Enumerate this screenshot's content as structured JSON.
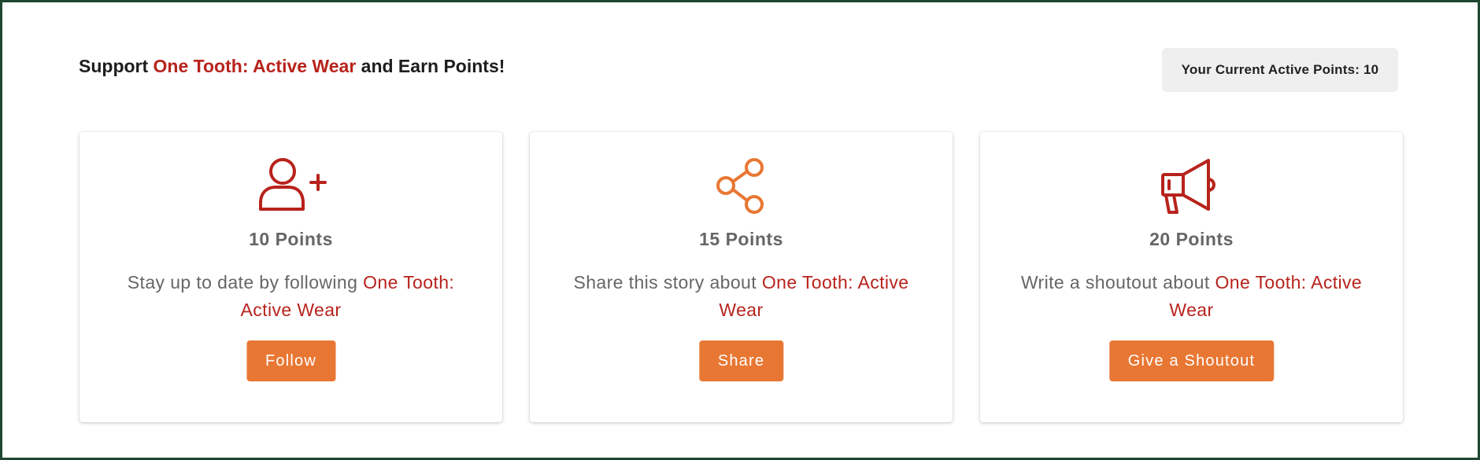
{
  "header": {
    "headline_prefix": "Support",
    "brand_name": "One Tooth: Active Wear",
    "headline_suffix": "and Earn Points!",
    "points_badge": "Your Current Active Points: 10"
  },
  "cards": [
    {
      "icon": "user-plus-icon",
      "points": "10 Points",
      "desc_prefix": "Stay up to date by following",
      "desc_brand": "One Tooth: Active Wear",
      "button_label": "Follow"
    },
    {
      "icon": "share-icon",
      "points": "15 Points",
      "desc_prefix": "Share this story about",
      "desc_brand": "One Tooth: Active Wear",
      "button_label": "Share"
    },
    {
      "icon": "megaphone-icon",
      "points": "20 Points",
      "desc_prefix": "Write a shoutout about",
      "desc_brand": "One Tooth: Active Wear",
      "button_label": "Give a Shoutout"
    }
  ],
  "colors": {
    "brand_red": "#b7231c",
    "accent_orange": "#e87733",
    "frame_border": "#1e4630",
    "badge_bg": "#efefef"
  }
}
